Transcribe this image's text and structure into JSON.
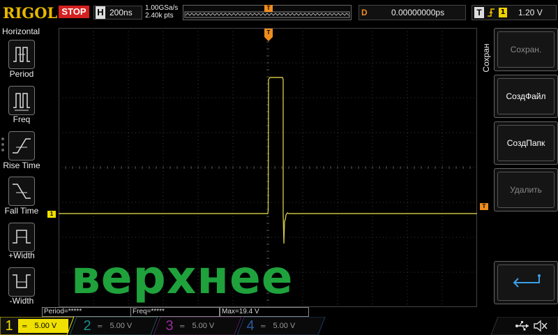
{
  "topbar": {
    "brand": "RIGOL",
    "run_state": "STOP",
    "horizontal": {
      "letter": "H",
      "timebase": "200ns"
    },
    "sample_rate": "1.00GSa/s",
    "memory_depth": "2.40k pts",
    "delay": {
      "letter": "D",
      "value": "0.00000000ps"
    },
    "trigger": {
      "letter": "T",
      "edge_icon": "rising-edge-icon",
      "source": "1",
      "level": "1.20 V"
    }
  },
  "left_menu": {
    "title": "Horizontal",
    "items": [
      {
        "label": "Period",
        "icon": "period-icon"
      },
      {
        "label": "Freq",
        "icon": "freq-icon"
      },
      {
        "label": "Rise Time",
        "icon": "rise-time-icon"
      },
      {
        "label": "Fall Time",
        "icon": "fall-time-icon"
      },
      {
        "label": "+Width",
        "icon": "positive-width-icon"
      },
      {
        "label": "-Width",
        "icon": "negative-width-icon"
      }
    ]
  },
  "right_menu": {
    "title": "Сохран",
    "buttons": [
      {
        "label": "Сохран.",
        "enabled": false
      },
      {
        "label": "СоздФайл",
        "enabled": true
      },
      {
        "label": "СоздПапк",
        "enabled": true
      },
      {
        "label": "Удалить",
        "enabled": false
      },
      {
        "label": "",
        "icon": "return-arrow-icon",
        "enabled": true
      }
    ]
  },
  "markers": {
    "trigger_top": "T",
    "ch1_level": "1",
    "trigger_level": "T"
  },
  "measurements": [
    {
      "label": "Period=*****"
    },
    {
      "label": "Freq=*****"
    },
    {
      "label": "Max=19.4 V"
    }
  ],
  "channels": [
    {
      "number": "1",
      "scale": "5.00 V",
      "active": true,
      "color": "#f0e000"
    },
    {
      "number": "2",
      "scale": "5.00 V",
      "active": false,
      "color": "#1e8c8c"
    },
    {
      "number": "3",
      "scale": "5.00 V",
      "active": false,
      "color": "#9a2a9a"
    },
    {
      "number": "4",
      "scale": "5.00 V",
      "active": false,
      "color": "#2a5aa0"
    }
  ],
  "status_icons": [
    "usb-icon",
    "speaker-mute-icon"
  ],
  "overlay_text": "верхнее",
  "colors": {
    "trace": "#c8c040",
    "trigger_marker": "#f08c1c",
    "stop": "#d42020",
    "brand": "#e8b800",
    "overlay": "#1fa13c"
  }
}
